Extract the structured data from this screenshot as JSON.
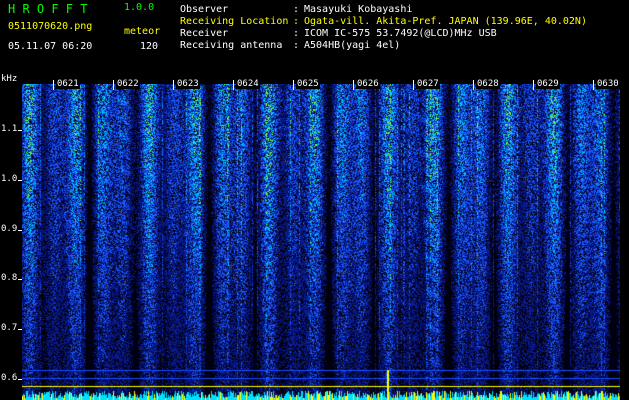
{
  "app": {
    "title": "H R O F F T",
    "version": "1.0.0"
  },
  "file": {
    "name": "0511070620.png",
    "datetime": "05.11.07 06:20",
    "meteor_label": "meteor",
    "meteor_count": "120"
  },
  "info": [
    {
      "label": "Observer",
      "colon": ":",
      "value": "Masayuki Kobayashi"
    },
    {
      "label": "Receiving Location",
      "colon": ":",
      "value": "Ogata-vill. Akita-Pref. JAPAN (139.96E, 40.02N)"
    },
    {
      "label": "Receiver",
      "colon": ":",
      "value": "ICOM IC-575 53.7492(@LCD)MHz USB"
    },
    {
      "label": "Receiving antenna",
      "colon": ":",
      "value": "A504HB(yagi 4el)"
    }
  ],
  "spectrogram": {
    "y_unit": "kHz",
    "y_ticks": [
      "1.1",
      "1.0",
      "0.9",
      "0.8",
      "0.7",
      "0.6"
    ],
    "y_values": [
      1.1,
      1.0,
      0.9,
      0.8,
      0.7,
      0.6
    ],
    "x_ticks": [
      "0621",
      "0622",
      "0623",
      "0624",
      "0625",
      "0626",
      "0627",
      "0628",
      "0629",
      "0630"
    ],
    "colors": {
      "background": "#000010",
      "low": "#0a1a8c",
      "mid": "#1a5cff",
      "high": "#00c8ff",
      "peak": "#7fff40",
      "carrier": "#ffff00",
      "baseline": "#00e0ff"
    }
  }
}
